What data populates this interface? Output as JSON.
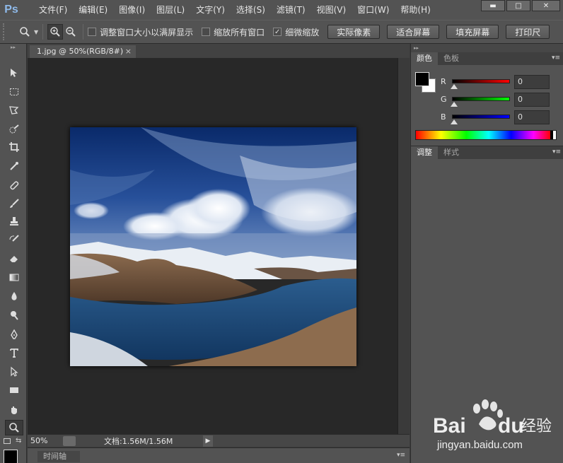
{
  "app": {
    "logo": "Ps"
  },
  "menu": [
    "文件(F)",
    "编辑(E)",
    "图像(I)",
    "图层(L)",
    "文字(Y)",
    "选择(S)",
    "滤镜(T)",
    "视图(V)",
    "窗口(W)",
    "帮助(H)"
  ],
  "window_buttons": {
    "minimize": "▬",
    "maximize": "□",
    "close": "✕"
  },
  "options": {
    "checkbox_resize": {
      "label": "调整窗口大小以满屏显示",
      "checked": false
    },
    "checkbox_zoom_all": {
      "label": "缩放所有窗口",
      "checked": false
    },
    "checkbox_scrubby": {
      "label": "细微缩放",
      "checked": true,
      "mark": "✓"
    },
    "btn_actual": "实际像素",
    "btn_fit": "适合屏幕",
    "btn_fill": "填充屏幕",
    "btn_print": "打印尺"
  },
  "document": {
    "tab_title": "1.jpg @ 50%(RGB/8#)",
    "tab_close": "×"
  },
  "status": {
    "zoom": "50%",
    "doc_size": "文档:1.56M/1.56M",
    "arrow": "▶"
  },
  "timeline": {
    "label": "时间轴"
  },
  "color_panel": {
    "tabs": [
      "颜色",
      "色板"
    ],
    "sliders": [
      {
        "label": "R",
        "value": "0",
        "color_start": "#000000",
        "color_end": "#ff0000"
      },
      {
        "label": "G",
        "value": "0",
        "color_start": "#000000",
        "color_end": "#00ff00"
      },
      {
        "label": "B",
        "value": "0",
        "color_start": "#000000",
        "color_end": "#0000ff"
      }
    ]
  },
  "adjust_panel": {
    "tabs": [
      "调整",
      "样式"
    ]
  },
  "watermark": {
    "brand": "Bai",
    "brand2": "du",
    "suffix": "经验",
    "url": "jingyan.baidu.com"
  }
}
